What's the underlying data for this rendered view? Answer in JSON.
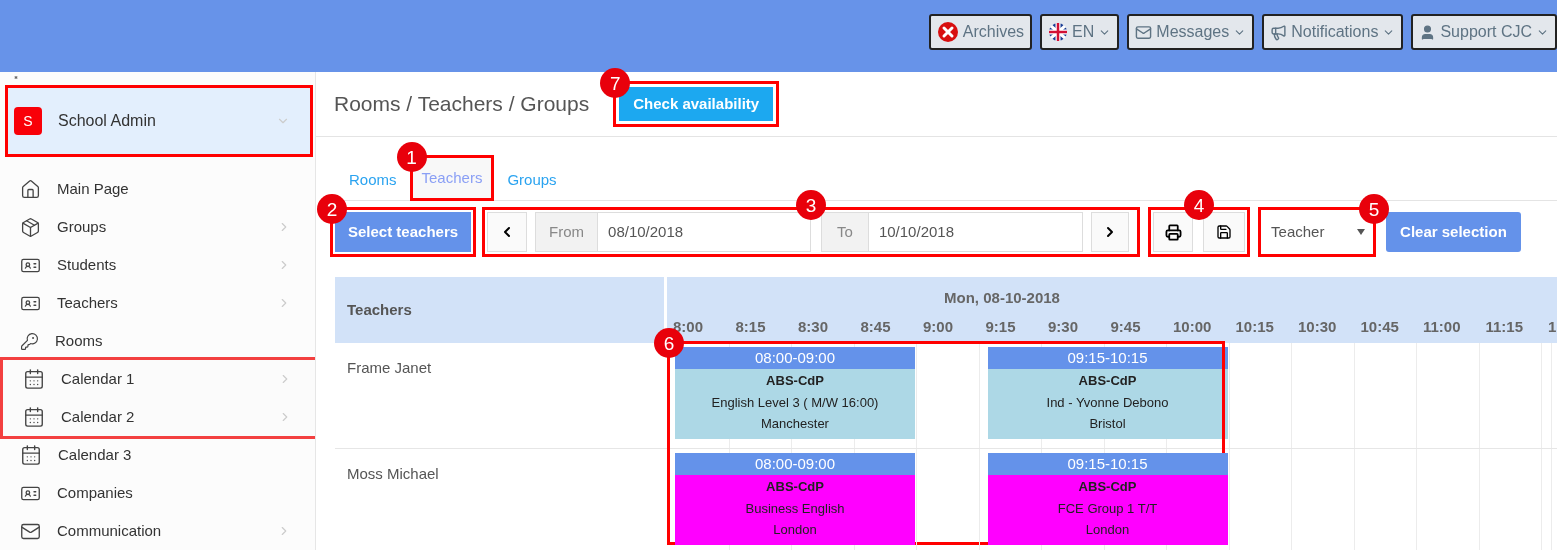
{
  "top_bar": {
    "buttons": [
      {
        "kind": "archives",
        "label": "Archives",
        "dropdown": false
      },
      {
        "kind": "language",
        "label": "EN",
        "dropdown": true
      },
      {
        "kind": "messages",
        "label": "Messages",
        "dropdown": true
      },
      {
        "kind": "notifications",
        "label": "Notifications",
        "dropdown": true
      },
      {
        "kind": "user",
        "label": "Support CJC",
        "dropdown": true
      }
    ]
  },
  "sidebar": {
    "account": {
      "initial": "S",
      "name": "School Admin"
    },
    "items": [
      {
        "kind": "home",
        "label": "Main Page",
        "has_children": false,
        "highlighted": false
      },
      {
        "kind": "box",
        "label": "Groups",
        "has_children": true,
        "highlighted": false
      },
      {
        "kind": "card",
        "label": "Students",
        "has_children": true,
        "highlighted": false
      },
      {
        "kind": "card",
        "label": "Teachers",
        "has_children": true,
        "highlighted": false
      },
      {
        "kind": "key",
        "label": "Rooms",
        "has_children": false,
        "highlighted": false
      },
      {
        "kind": "calendar",
        "label": "Calendar 1",
        "has_children": true,
        "highlighted": true
      },
      {
        "kind": "calendar",
        "label": "Calendar 2",
        "has_children": true,
        "highlighted": true
      },
      {
        "kind": "calendar",
        "label": "Calendar 3",
        "has_children": false,
        "highlighted": false
      },
      {
        "kind": "card",
        "label": "Companies",
        "has_children": false,
        "highlighted": false
      },
      {
        "kind": "mail",
        "label": "Communication",
        "has_children": true,
        "highlighted": false
      }
    ]
  },
  "page": {
    "breadcrumb": "Rooms / Teachers / Groups",
    "check_button": "Check availability",
    "check_callout": "7"
  },
  "tabs": {
    "callout": "1",
    "items": [
      {
        "label": "Rooms",
        "selected": false
      },
      {
        "label": "Teachers",
        "selected": true
      },
      {
        "label": "Groups",
        "selected": false
      }
    ]
  },
  "toolbar": {
    "select_button": "Select teachers",
    "select_callout": "2",
    "range_callout": "3",
    "from_label": "From",
    "from_value": "08/10/2018",
    "to_label": "To",
    "to_value": "10/10/2018",
    "actions_callout": "4",
    "view_select": "Teacher",
    "view_callout": "5",
    "clear_button": "Clear selection"
  },
  "schedule": {
    "column_heading": "Teachers",
    "date": "Mon, 08-10-2018",
    "ticks": [
      "8:00",
      "8:15",
      "8:30",
      "8:45",
      "9:00",
      "9:15",
      "9:30",
      "9:45",
      "10:00",
      "10:15",
      "10:30",
      "10:45",
      "11:00",
      "11:15",
      "1"
    ],
    "events_callout": "6",
    "rows": [
      {
        "teacher": "Frame Janet",
        "events": [
          {
            "time": "08:00-09:00",
            "code": "ABS-CdP",
            "course": "English Level 3 ( M/W 16:00)",
            "place": "Manchester",
            "color": "#add8e6"
          },
          {
            "time": "09:15-10:15",
            "code": "ABS-CdP",
            "course": "Ind - Yvonne Debono",
            "place": "Bristol",
            "color": "#add8e6"
          }
        ]
      },
      {
        "teacher": "Moss Michael",
        "events": [
          {
            "time": "08:00-09:00",
            "code": "ABS-CdP",
            "course": "Business English",
            "place": "London",
            "color": "#ff00ff"
          },
          {
            "time": "09:15-10:15",
            "code": "ABS-CdP",
            "course": "FCE Group 1 T/T",
            "place": "London",
            "color": "#ff00ff"
          }
        ]
      }
    ]
  }
}
